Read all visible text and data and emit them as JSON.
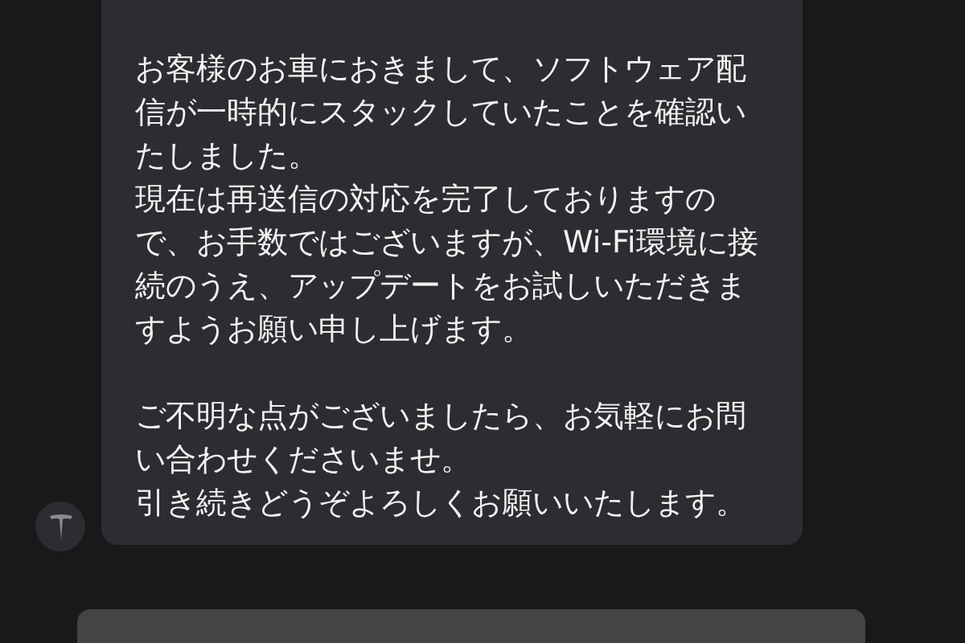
{
  "message": {
    "paragraphs": [
      [
        "お客様のお車におきまして、ソフトウェア配信が一時的にスタックしていたことを確認いたしました。",
        "現在は再送信の対応を完了しておりますので、お手数ではございますが、Wi-Fi環境に接続のうえ、アップデートをお試しいただきますようお願い申し上げます。"
      ],
      [
        "ご不明な点がございましたら、お気軽にお問い合わせくださいませ。",
        "引き続きどうぞよろしくお願いいたします。"
      ]
    ]
  }
}
